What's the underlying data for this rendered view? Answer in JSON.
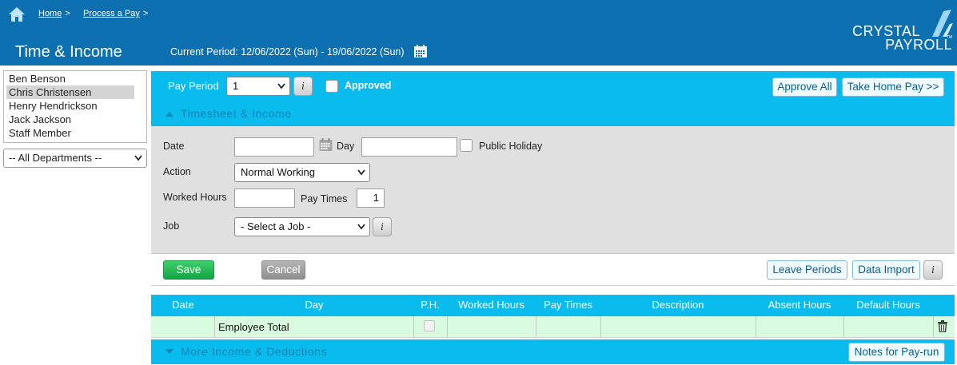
{
  "breadcrumb": {
    "items": [
      {
        "label": "Home",
        "sep": ">"
      },
      {
        "label": "Process a Pay",
        "sep": ">"
      }
    ]
  },
  "page": {
    "title": "Time & Income",
    "current_period": "Current Period: 12/06/2022 (Sun) - 19/06/2022 (Sun)"
  },
  "logo": {
    "line1": "CRYSTAL",
    "line2": "PAYROLL",
    "tm": "TM"
  },
  "employees": [
    {
      "name": "Ben Benson",
      "selected": false
    },
    {
      "name": "Chris Christensen",
      "selected": true
    },
    {
      "name": "Henry Hendrickson",
      "selected": false
    },
    {
      "name": "Jack Jackson",
      "selected": false
    },
    {
      "name": "Staff Member",
      "selected": false
    }
  ],
  "department_filter": {
    "selected": "-- All Departments --"
  },
  "pay_bar": {
    "pay_period_label": "Pay Period",
    "pay_period_value": "1",
    "info_label": "i",
    "approved_label": "Approved",
    "approved_checked": false,
    "approve_all_label": "Approve All",
    "take_home_label": "Take Home Pay >>"
  },
  "timesheet": {
    "section_title": "Timesheet & Income",
    "date_label": "Date",
    "date_value": "",
    "day_label": "Day",
    "day_value": "",
    "public_holiday_label": "Public Holiday",
    "action_label": "Action",
    "action_value": "Normal Working",
    "worked_hours_label": "Worked Hours",
    "worked_hours_value": "",
    "pay_times_label": "Pay Times",
    "pay_times_value": "1",
    "job_label": "Job",
    "job_value": "- Select a Job -"
  },
  "actions": {
    "save": "Save",
    "cancel": "Cancel",
    "leave_periods": "Leave Periods",
    "data_import": "Data Import"
  },
  "table": {
    "columns": [
      "Date",
      "Day",
      "P.H.",
      "Worked Hours",
      "Pay Times",
      "Description",
      "Absent Hours",
      "Default Hours"
    ],
    "total_row_label": "Employee Total"
  },
  "more_section": {
    "title": "More Income & Deductions",
    "notes_button": "Notes for Pay-run"
  },
  "colors": {
    "header_blue": "#0b6fb0",
    "bar_cyan": "#0abbee",
    "save_green": "#14a446",
    "total_row_green": "#d9fbe0"
  }
}
